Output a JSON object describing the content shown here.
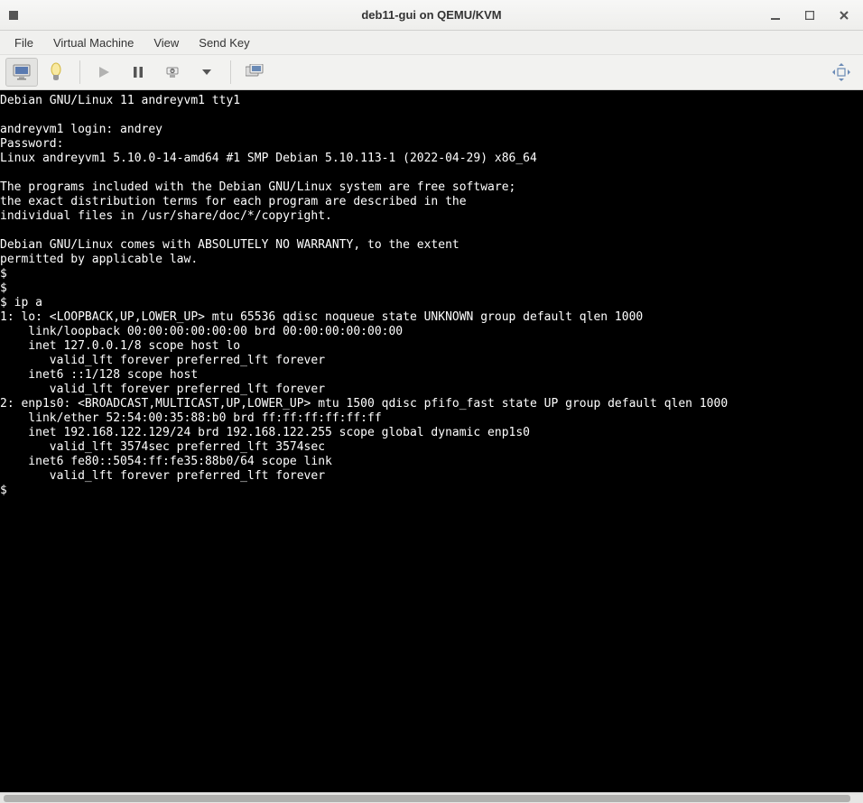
{
  "window": {
    "title": "deb11-gui on QEMU/KVM"
  },
  "menu": {
    "file": "File",
    "vm": "Virtual Machine",
    "view": "View",
    "sendkey": "Send Key"
  },
  "console": {
    "lines": [
      "Debian GNU/Linux 11 andreyvm1 tty1",
      "",
      "andreyvm1 login: andrey",
      "Password:",
      "Linux andreyvm1 5.10.0-14-amd64 #1 SMP Debian 5.10.113-1 (2022-04-29) x86_64",
      "",
      "The programs included with the Debian GNU/Linux system are free software;",
      "the exact distribution terms for each program are described in the",
      "individual files in /usr/share/doc/*/copyright.",
      "",
      "Debian GNU/Linux comes with ABSOLUTELY NO WARRANTY, to the extent",
      "permitted by applicable law.",
      "$",
      "$",
      "$ ip a",
      "1: lo: <LOOPBACK,UP,LOWER_UP> mtu 65536 qdisc noqueue state UNKNOWN group default qlen 1000",
      "    link/loopback 00:00:00:00:00:00 brd 00:00:00:00:00:00",
      "    inet 127.0.0.1/8 scope host lo",
      "       valid_lft forever preferred_lft forever",
      "    inet6 ::1/128 scope host",
      "       valid_lft forever preferred_lft forever",
      "2: enp1s0: <BROADCAST,MULTICAST,UP,LOWER_UP> mtu 1500 qdisc pfifo_fast state UP group default qlen 1000",
      "    link/ether 52:54:00:35:88:b0 brd ff:ff:ff:ff:ff:ff",
      "    inet 192.168.122.129/24 brd 192.168.122.255 scope global dynamic enp1s0",
      "       valid_lft 3574sec preferred_lft 3574sec",
      "    inet6 fe80::5054:ff:fe35:88b0/64 scope link",
      "       valid_lft forever preferred_lft forever",
      "$"
    ]
  }
}
